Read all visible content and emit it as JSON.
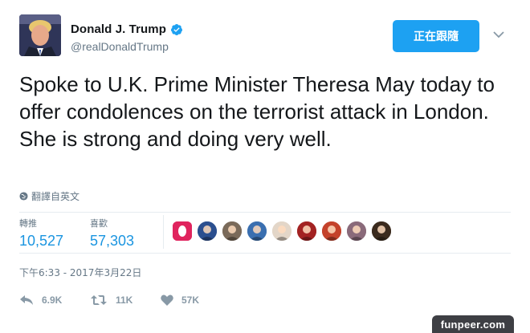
{
  "user": {
    "display_name": "Donald J. Trump",
    "handle": "@realDonaldTrump",
    "verified_icon": "verified-badge-icon"
  },
  "follow_button": {
    "label": "正在跟隨"
  },
  "tweet": {
    "text": "Spoke to U.K. Prime Minister Theresa May today to offer condolences on the terrorist attack in London. She is strong and doing very well.",
    "translate_label": "翻譯自英文"
  },
  "stats": {
    "retweets_label": "轉推",
    "retweets_value": "10,527",
    "likes_label": "喜歡",
    "likes_value": "57,303"
  },
  "likers": [
    {
      "color": "#e0245e"
    },
    {
      "color": "#2b4f8f"
    },
    {
      "color": "#7a6a5a"
    },
    {
      "color": "#3a6fb0"
    },
    {
      "color": "#e3d6c8"
    },
    {
      "color": "#a32222"
    },
    {
      "color": "#c4422b"
    },
    {
      "color": "#8a6a7a"
    },
    {
      "color": "#3b2b1e"
    }
  ],
  "timestamp": "下午6:33 - 2017年3月22日",
  "actions": {
    "reply_count": "6.9K",
    "retweet_count": "11K",
    "like_count": "57K"
  },
  "watermark": "funpeer.com",
  "colors": {
    "accent": "#1da1f2",
    "link": "#1b95e0",
    "muted": "#657786"
  }
}
